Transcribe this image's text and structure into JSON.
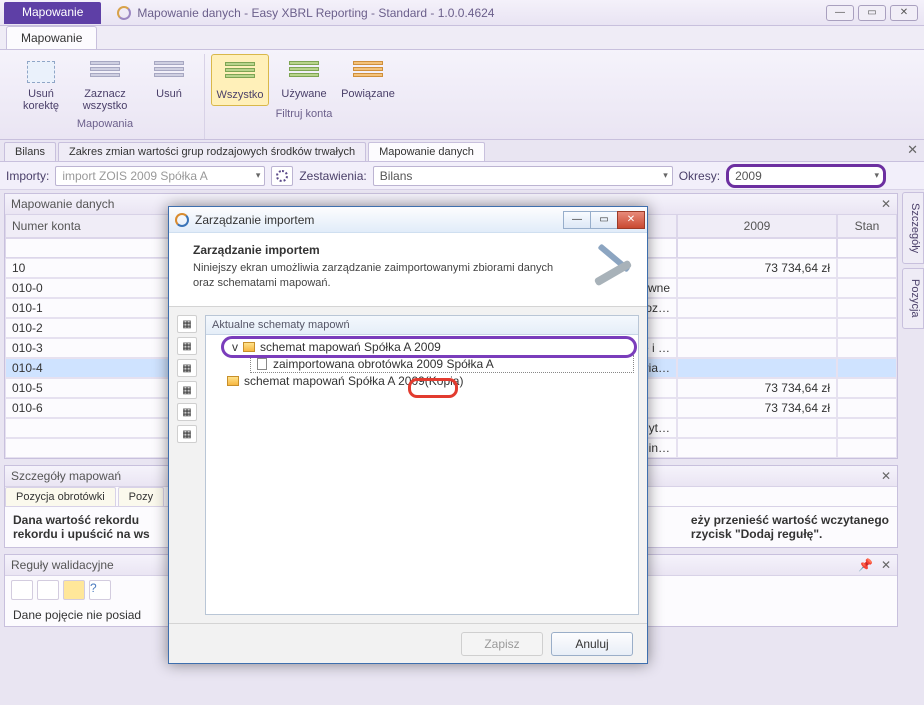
{
  "window": {
    "app_tab": "Mapowanie",
    "title": "Mapowanie danych - Easy XBRL Reporting - Standard - 1.0.0.4624",
    "controls": {
      "min": "—",
      "max": "▭",
      "close": "✕"
    }
  },
  "ribbon": {
    "tab": "Mapowanie",
    "group_mapowania": {
      "title": "Mapowania",
      "btn_usun_korekte": "Usuń korektę",
      "btn_zaznacz_wszystko": "Zaznacz\nwszystko",
      "btn_usun": "Usuń"
    },
    "group_filtruj": {
      "title": "Filtruj konta",
      "btn_wszystko": "Wszystko",
      "btn_uzywane": "Używane",
      "btn_powiazane": "Powiązane"
    }
  },
  "doc_tabs": {
    "t1": "Bilans",
    "t2": "Zakres zmian wartości grup rodzajowych środków trwałych",
    "t3": "Mapowanie danych"
  },
  "filters": {
    "importy_label": "Importy:",
    "importy_value": "import ZOIS 2009 Spółka A",
    "zestawienia_label": "Zestawienia:",
    "zestawienia_value": "Bilans",
    "okresy_label": "Okresy:",
    "okresy_value": "2009"
  },
  "sidepanels": {
    "s1": "Szczegóły",
    "s2": "Pozycja"
  },
  "grid": {
    "title": "Mapowanie danych",
    "col_numer": "Numer konta",
    "col_year": "2009",
    "col_stan": "Stan",
    "rows": [
      {
        "nk": "10",
        "val": "73 734,64 zł",
        "txt": ""
      },
      {
        "nk": "010-0",
        "val": "",
        "txt": "wne"
      },
      {
        "nk": "010-1",
        "val": "",
        "txt": "rac roz…"
      },
      {
        "nk": "010-2",
        "val": "",
        "txt": ""
      },
      {
        "nk": "010-3",
        "val": "",
        "txt": "alne i …"
      },
      {
        "nk": "010-4",
        "val": "",
        "txt": "ateria…"
      },
      {
        "nk": "010-5",
        "val": "73 734,64 zł",
        "txt": ""
      },
      {
        "nk": "010-6",
        "val": "73 734,64 zł",
        "txt": ""
      },
      {
        "nk": "",
        "val": "",
        "txt": "o użyt…"
      },
      {
        "nk": "",
        "val": "",
        "txt": "ekty in…"
      }
    ]
  },
  "details": {
    "title": "Szczegóły mapowań",
    "tab1": "Pozycja obrotówki",
    "tab2": "Pozy",
    "body_left": "Dana wartość rekordu",
    "body_left2": "rekordu i upuścić na ws",
    "body_right": "eży przenieść wartość wczytanego",
    "body_right2": "rzycisk \"Dodaj regułę\"."
  },
  "validation": {
    "title": "Reguły walidacyjne",
    "text": "Dane pojęcie nie posiad"
  },
  "dialog": {
    "title": "Zarządzanie importem",
    "heading": "Zarządzanie importem",
    "desc": "Niniejszy ekran umożliwia zarządzanie zaimportowanymi zbiorami danych oraz schematami mapowań.",
    "tree_hdr": "Aktualne schematy mapowń",
    "n1": "schemat mapowań Spółka A 2009",
    "n2": "zaimportowana obrotówka 2009 Spółka A",
    "n3": "schemat mapowań Spółka A 2009(Kopia)",
    "btn_save": "Zapisz",
    "btn_cancel": "Anuluj",
    "controls": {
      "min": "—",
      "max": "▭",
      "close": "✕"
    }
  }
}
